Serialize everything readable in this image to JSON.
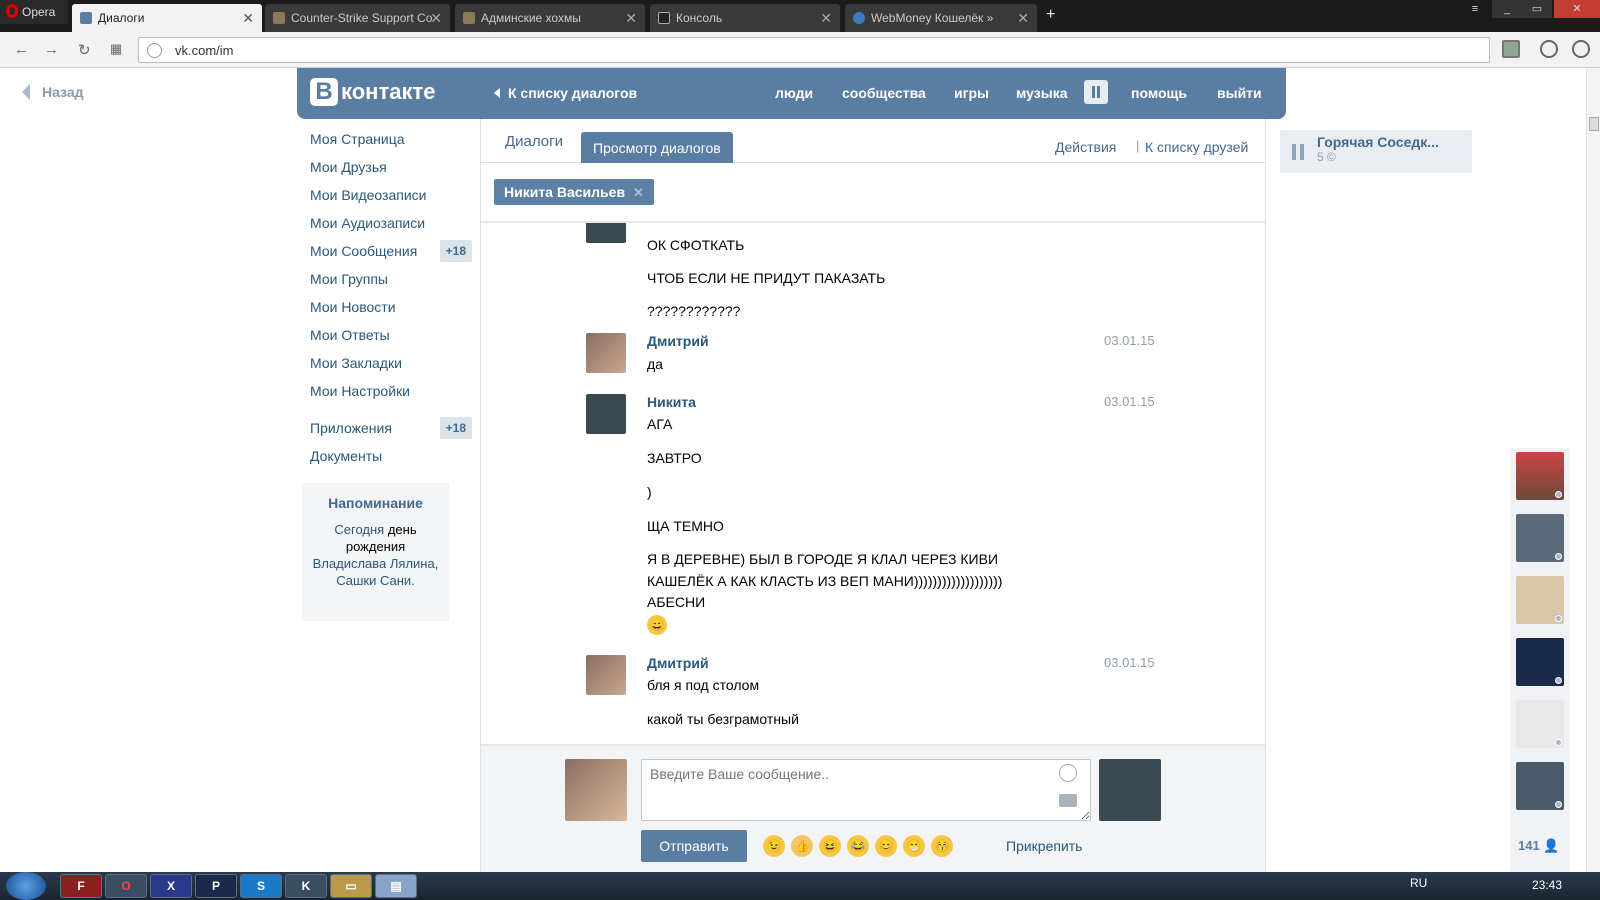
{
  "browser": {
    "opera_label": "Opera",
    "tabs": [
      {
        "title": "Диалоги",
        "active": true
      },
      {
        "title": "Counter-Strike Support Co",
        "active": false
      },
      {
        "title": "Админские хохмы",
        "active": false
      },
      {
        "title": "Консоль",
        "active": false
      },
      {
        "title": "WebMoney Кошелёк »",
        "active": false
      }
    ],
    "url": "vk.com/im"
  },
  "page": {
    "back_label": "Назад",
    "logo_text": "контакте",
    "logo_letter": "B",
    "to_dialogs": "К списку диалогов",
    "topnav": [
      "люди",
      "сообщества",
      "игры",
      "музыка",
      "помощь",
      "выйти"
    ]
  },
  "menu": {
    "items": [
      {
        "label": "Моя Страница"
      },
      {
        "label": "Мои Друзья"
      },
      {
        "label": "Мои Видеозаписи"
      },
      {
        "label": "Мои Аудиозаписи"
      },
      {
        "label": "Мои Сообщения",
        "count": "+18"
      },
      {
        "label": "Мои Группы"
      },
      {
        "label": "Мои Новости"
      },
      {
        "label": "Мои Ответы"
      },
      {
        "label": "Мои Закладки"
      },
      {
        "label": "Мои Настройки"
      }
    ],
    "apps": {
      "label": "Приложения",
      "count": "+18"
    },
    "docs": "Документы"
  },
  "reminder": {
    "title": "Напоминание",
    "text_1": "Сегодня",
    "text_2": "день рождения",
    "text_3": "Владислава Лялина, Сашки Сани."
  },
  "main": {
    "tab_dialogs": "Диалоги",
    "tab_view": "Просмотр диалогов",
    "actions": "Действия",
    "sep": "|",
    "to_friends": "К списку друзей",
    "peer_pill": "Никита Васильев",
    "pill_close": "✕"
  },
  "messages": {
    "m0": [
      "ОК СФОТКАТЬ",
      "ЧТОБ ЕСЛИ НЕ ПРИДУТ ПАКАЗАТЬ",
      "????????????"
    ],
    "m1": {
      "name": "Дмитрий",
      "date": "03.01.15",
      "lines": [
        "да"
      ]
    },
    "m2": {
      "name": "Никита",
      "date": "03.01.15",
      "lines": [
        "АГА",
        "ЗАВТРО",
        ")",
        "ЩА ТЕМНО",
        "Я В ДЕРЕВНЕ) БЫЛ В ГОРОДЕ Я КЛАЛ ЧЕРЕЗ КИВИ",
        "КАШЕЛЁК А КАК КЛАСТЬ ИЗ ВЕП МАНИ)))))))))))))))))))",
        "АБЕСНИ"
      ]
    },
    "m3": {
      "name": "Дмитрий",
      "date": "03.01.15",
      "lines": [
        "бля я под столом",
        "какой ты безграмотный"
      ]
    }
  },
  "composer": {
    "placeholder": "Введите Ваше сообщение..",
    "send": "Отправить",
    "attach": "Прикрепить"
  },
  "player": {
    "title": "Горячая Соседк...",
    "sub": "5 ©"
  },
  "friends_count": "141",
  "taskbar": {
    "lang": "RU",
    "clock": "23:43"
  }
}
